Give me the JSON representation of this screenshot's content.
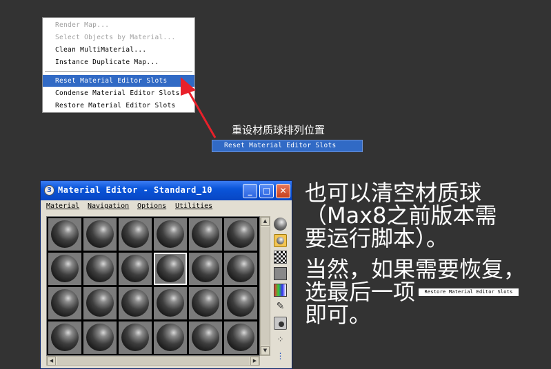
{
  "context_menu": {
    "items": [
      {
        "label": "Render Map...",
        "disabled": true
      },
      {
        "label": "Select Objects by Material...",
        "disabled": true
      },
      {
        "label": "Clean MultiMaterial...",
        "disabled": false
      },
      {
        "label": "Instance Duplicate Map...",
        "disabled": false
      },
      {
        "label": "Reset Material Editor Slots",
        "selected": true
      },
      {
        "label": "Condense Material Editor Slots",
        "disabled": false
      },
      {
        "label": "Restore Material Editor Slots",
        "disabled": false
      }
    ]
  },
  "callout": {
    "caption": "重设材质球排列位置",
    "highlight_label": "Reset Material Editor Slots",
    "arrow_color": "#e8202a"
  },
  "material_editor": {
    "title": "Material Editor - Standard_10",
    "menus": [
      "Material",
      "Navigation",
      "Options",
      "Utilities"
    ],
    "slot_rows": 4,
    "slot_cols": 6,
    "active_slot_index": 9,
    "tool_icons": [
      "sample-type-sphere-icon",
      "backlight-icon",
      "background-checker-icon",
      "sample-uv-tiling-icon",
      "video-color-check-icon",
      "make-preview-icon",
      "options-icon",
      "select-by-material-icon",
      "material-map-navigator-icon"
    ]
  },
  "note": {
    "line1": "也可以清空材质球",
    "line2": "（Max8之前版本需",
    "line3": "要运行脚本）。",
    "line4": "当然，如果需要恢复，",
    "line5": "选最后一项",
    "line5_inline_label": "Restore Material Editor Slots",
    "line6": "即可。"
  },
  "colors": {
    "background": "#333333",
    "highlight": "#316ac5",
    "titlebar": "#0a55d9"
  }
}
